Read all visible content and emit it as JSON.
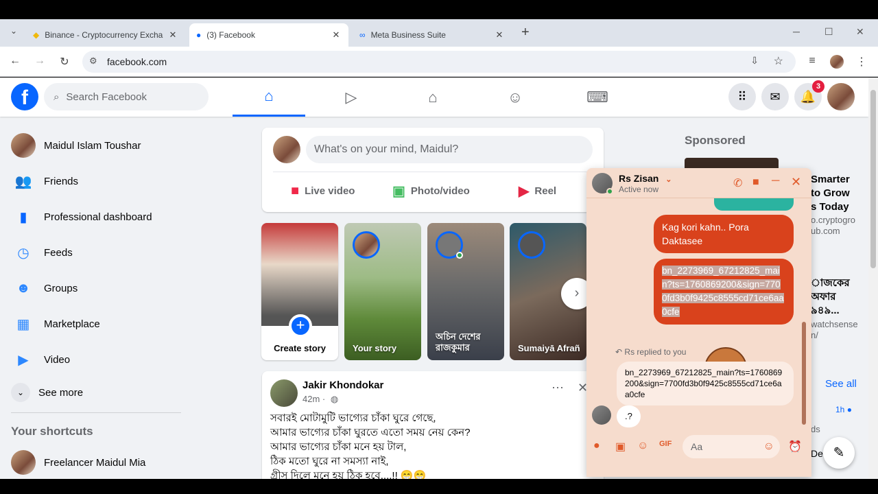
{
  "browser": {
    "tabs": [
      {
        "label": "Binance - Cryptocurrency Excha",
        "icon": "binance-icon"
      },
      {
        "label": "(3) Facebook",
        "icon": "facebook-icon"
      },
      {
        "label": "Meta Business Suite",
        "icon": "meta-icon"
      }
    ],
    "new_tab": "+",
    "url": "facebook.com",
    "window_controls": {
      "minimize": "─",
      "maximize": "☐",
      "close": "✕"
    }
  },
  "header": {
    "logo": "f",
    "search_placeholder": "Search Facebook",
    "notification_count": "3"
  },
  "sidebar": {
    "profile_name": "Maidul Islam Toushar",
    "items": [
      {
        "label": "Friends",
        "icon": "friends-icon"
      },
      {
        "label": "Professional dashboard",
        "icon": "dashboard-icon"
      },
      {
        "label": "Feeds",
        "icon": "feeds-icon"
      },
      {
        "label": "Groups",
        "icon": "groups-icon"
      },
      {
        "label": "Marketplace",
        "icon": "marketplace-icon"
      },
      {
        "label": "Video",
        "icon": "video-icon"
      }
    ],
    "see_more": "See more",
    "shortcuts_title": "Your shortcuts",
    "shortcut": "Freelancer Maidul Mia"
  },
  "composer": {
    "placeholder": "What's on your mind, Maidul?",
    "actions": [
      "Live video",
      "Photo/video",
      "Reel"
    ]
  },
  "stories": [
    {
      "name": "Create story"
    },
    {
      "name": "Your story"
    },
    {
      "name": "অচিন দেশের রাজকুমার"
    },
    {
      "name": "Sumaiyā Afrañ"
    }
  ],
  "post": {
    "author": "Jakir Khondokar",
    "time": "42m ·",
    "lines": [
      "সবারই মোটামুটি ভাগ্যের চাঁকা ঘুরে গেছে,",
      "আমার ভাগ্যের চাঁকা ঘুরতে এতো সময় নেয় কেন?",
      "আমার ভাগ্যের চাঁকা  মনে হয় টাল,",
      " ঠিক মতো ঘুরে না সমস্যা নাই,",
      "গ্রীস দিলে মনে হয় ঠিক হবে....!! 😁😁"
    ]
  },
  "sponsored": {
    "title": "Sponsored",
    "ad1_lines": [
      "Smarter",
      "to Grow",
      "s Today"
    ],
    "ad1_url": "o.cryptogro ub.com",
    "ad2_lines": [
      "াজকের",
      "অফার",
      "৯৪৯..."
    ],
    "ad2_url": "watchsense n/",
    "see_all": "See all",
    "time": "1h",
    "fragment1": "ds",
    "fragment2": "De"
  },
  "chat": {
    "name": "Rs Zisan",
    "status": "Active now",
    "msg1": "Kag kori kahn.. Pora Daktasee",
    "msg2": "bn_2273969_67212825_main?ts=1760869200&sign=7700fd3b0f9425c8555cd71ce6aa0cfe",
    "reply_label": "Rs replied to you",
    "reply_quote": "bn_2273969_67212825_main?ts=1760869200&sign=7700fd3b0f9425c8555cd71ce6aa0cfe",
    "reply": ".?",
    "input_placeholder": "Aa"
  },
  "colors": {
    "fb_blue": "#0866ff",
    "chat_accent": "#d9421c",
    "chat_bg": "#f6dccd"
  }
}
